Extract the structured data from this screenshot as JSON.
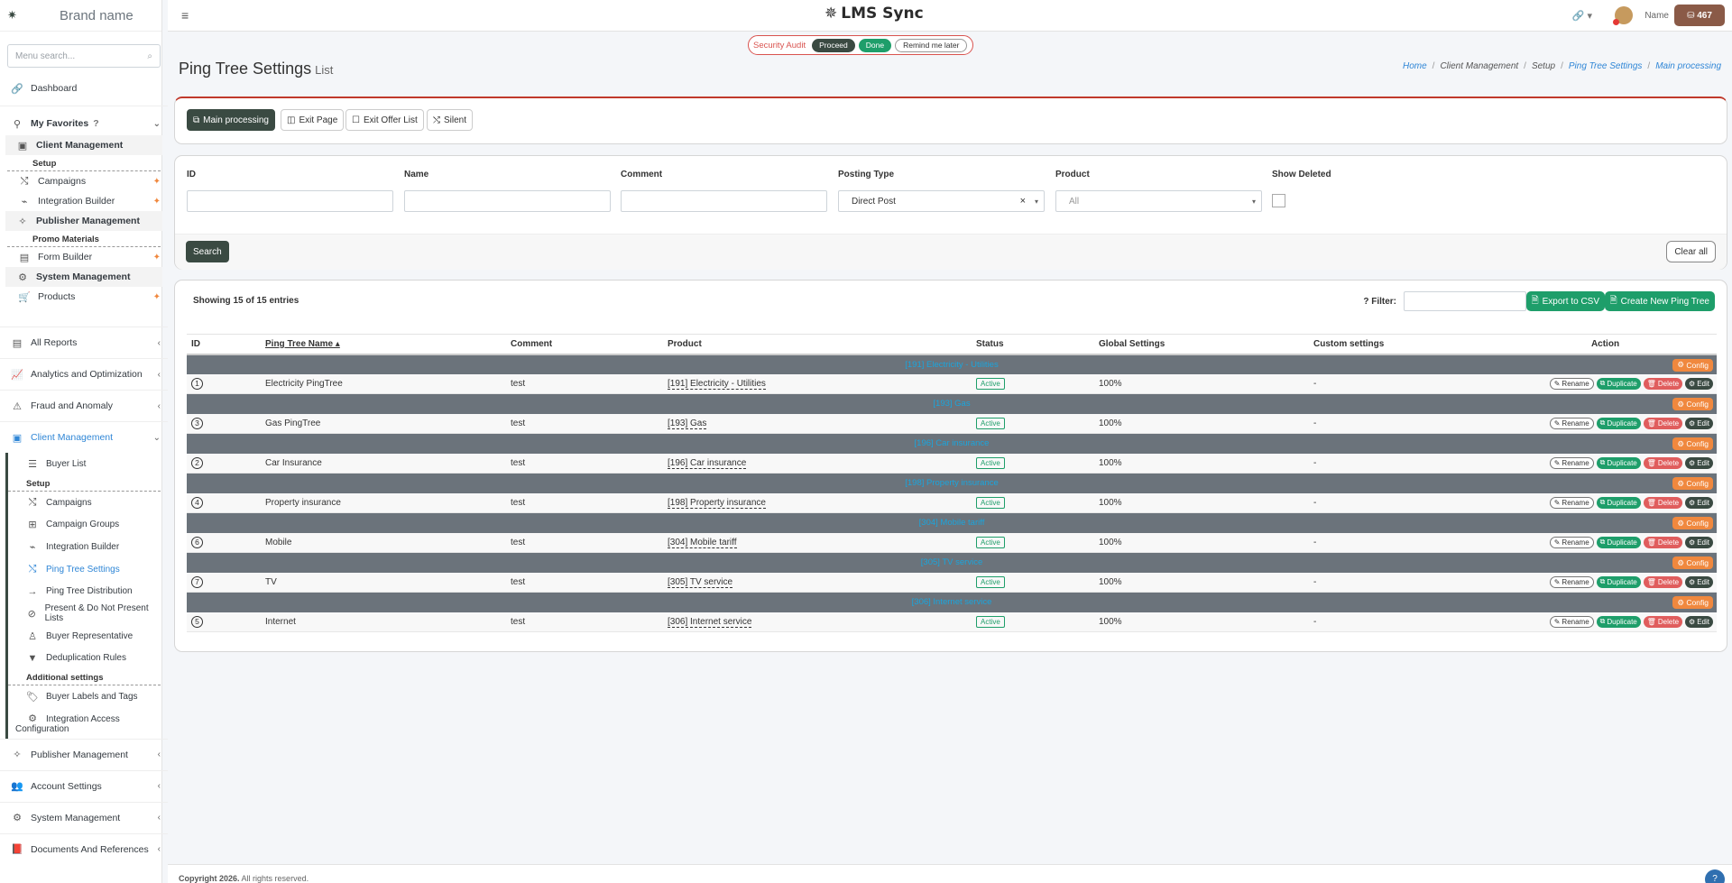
{
  "brand": {
    "name": "Brand name",
    "logo_icon": "sparkle-icon"
  },
  "sidebar": {
    "search_placeholder": "Menu search...",
    "dashboard": "Dashboard",
    "favorites": {
      "label": "My Favorites",
      "client_management": "Client Management",
      "setup": "Setup",
      "campaigns": "Campaigns",
      "integration_builder": "Integration Builder",
      "publisher_management": "Publisher Management",
      "promo_materials": "Promo Materials",
      "form_builder": "Form Builder",
      "system_management": "System Management",
      "products": "Products"
    },
    "all_reports": "All Reports",
    "analytics": "Analytics and Optimization",
    "fraud": "Fraud and Anomaly",
    "client_management": "Client Management",
    "cm_items": {
      "buyer_list": "Buyer List",
      "setup": "Setup",
      "campaigns": "Campaigns",
      "campaign_groups": "Campaign Groups",
      "integration_builder": "Integration Builder",
      "ping_tree_settings": "Ping Tree Settings",
      "ping_tree_distribution": "Ping Tree Distribution",
      "present_lists": "Present & Do Not Present Lists",
      "buyer_rep": "Buyer Representative",
      "dedup_rules": "Deduplication Rules",
      "additional_settings": "Additional settings",
      "buyer_labels": "Buyer Labels and Tags",
      "integration_access_1": "Integration Access",
      "integration_access_2": "Configuration"
    },
    "publisher_management": "Publisher Management",
    "account_settings": "Account Settings",
    "system_management": "System Management",
    "documents": "Documents And References"
  },
  "topbar": {
    "app_name": "LMS Sync",
    "user_name": "Name",
    "credits": "467"
  },
  "audit": {
    "label": "Security Audit",
    "proceed": "Proceed",
    "done": "Done",
    "remind": "Remind me later"
  },
  "page": {
    "title": "Ping Tree Settings",
    "subtitle": "List",
    "breadcrumb": [
      "Home",
      "Client Management",
      "Setup",
      "Ping Tree Settings",
      "Main processing"
    ]
  },
  "tabs": [
    "Main processing",
    "Exit Page",
    "Exit Offer List",
    "Silent"
  ],
  "filters": {
    "id_label": "ID",
    "name_label": "Name",
    "comment_label": "Comment",
    "posting_type_label": "Posting Type",
    "posting_type_value": "Direct Post",
    "product_label": "Product",
    "product_placeholder": "All",
    "show_deleted_label": "Show Deleted",
    "search_btn": "Search",
    "clear_btn": "Clear all"
  },
  "table": {
    "entries_info": "Showing 15 of 15 entries",
    "filter_label": "Filter:",
    "export_btn": "Export to CSV",
    "create_btn": "Create New Ping Tree",
    "headers": [
      "ID",
      "Ping Tree Name",
      "Comment",
      "Product",
      "Status",
      "Global Settings",
      "Custom settings",
      "Action"
    ],
    "config_label": "Config",
    "rename_label": "Rename",
    "duplicate_label": "Duplicate",
    "delete_label": "Delete",
    "edit_label": "Edit",
    "groups": [
      {
        "group": "[191] Electricity - Utilities",
        "id": "1",
        "name": "Electricity PingTree",
        "comment": "test",
        "product": "[191] Electricity - Utilities",
        "status": "Active",
        "global": "100%",
        "custom": "-"
      },
      {
        "group": "[193] Gas",
        "id": "3",
        "name": "Gas PingTree",
        "comment": "test",
        "product": "[193] Gas",
        "status": "Active",
        "global": "100%",
        "custom": "-"
      },
      {
        "group": "[196] Car insurance",
        "id": "2",
        "name": "Car Insurance",
        "comment": "test",
        "product": "[196] Car insurance",
        "status": "Active",
        "global": "100%",
        "custom": "-"
      },
      {
        "group": "[198] Property insurance",
        "id": "4",
        "name": "Property insurance",
        "comment": "test",
        "product": "[198] Property insurance",
        "status": "Active",
        "global": "100%",
        "custom": "-"
      },
      {
        "group": "[304] Mobile tariff",
        "id": "6",
        "name": "Mobile",
        "comment": "test",
        "product": "[304] Mobile tariff",
        "status": "Active",
        "global": "100%",
        "custom": "-"
      },
      {
        "group": "[305] TV service",
        "id": "7",
        "name": "TV",
        "comment": "test",
        "product": "[305] TV service",
        "status": "Active",
        "global": "100%",
        "custom": "-"
      },
      {
        "group": "[306] Internet service",
        "id": "5",
        "name": "Internet",
        "comment": "test",
        "product": "[306] Internet service",
        "status": "Active",
        "global": "100%",
        "custom": "-"
      }
    ]
  },
  "footer": {
    "copyright": "Copyright 2026.",
    "rights": "All rights reserved."
  }
}
